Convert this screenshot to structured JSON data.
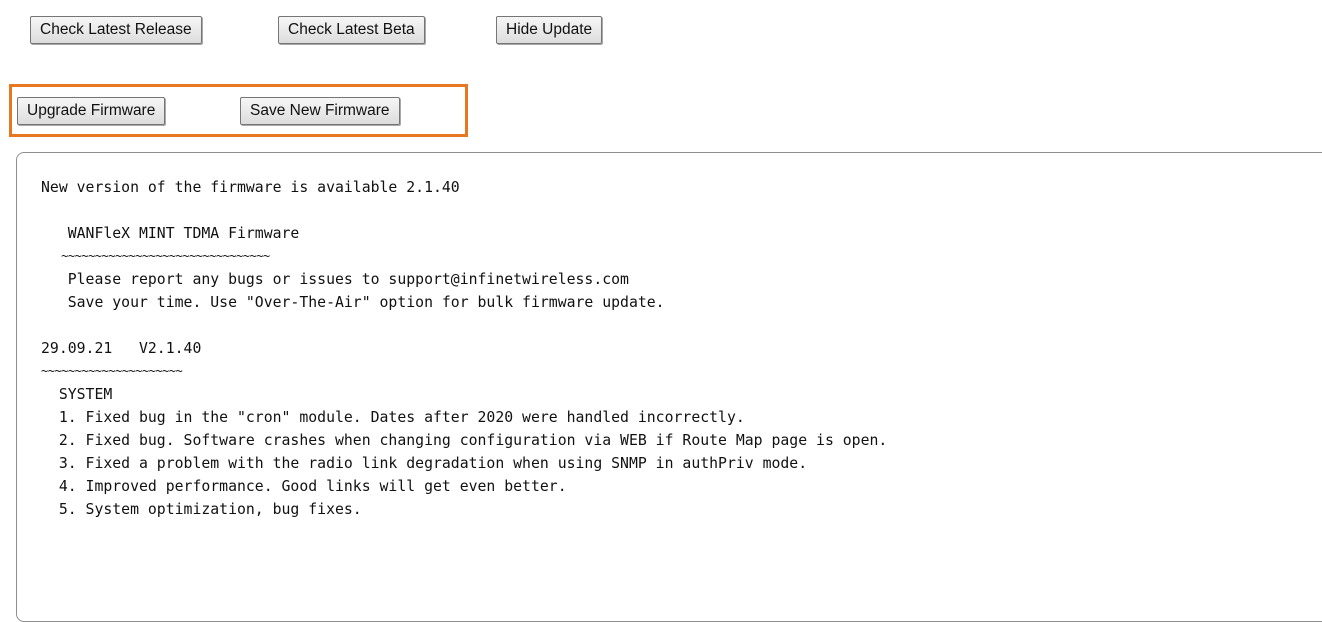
{
  "toolbar": {
    "check_latest_release": "Check Latest Release",
    "check_latest_beta": "Check Latest Beta",
    "hide_update": "Hide Update"
  },
  "firmware_actions": {
    "upgrade_firmware": "Upgrade Firmware",
    "save_new_firmware": "Save New Firmware",
    "highlight_color": "#e87722"
  },
  "release_notes": {
    "header": "New version of the firmware is available 2.1.40",
    "product_title": "   WANFleX MINT TDMA Firmware",
    "product_underline": "   ~~~~~~~~~~~~~~~~~~~~~~~~~~~~~~~",
    "report_line": "   Please report any bugs or issues to support@infinetwireless.com",
    "ota_line": "   Save your time. Use \"Over-The-Air\" option for bulk firmware update.",
    "version_line": "29.09.21   V2.1.40",
    "version_underline": "~~~~~~~~~~~~~~~~~~~~~",
    "section": "  SYSTEM",
    "items": [
      "  1. Fixed bug in the \"cron\" module. Dates after 2020 were handled incorrectly.",
      "  2. Fixed bug. Software crashes when changing configuration via WEB if Route Map page is open.",
      "  3. Fixed a problem with the radio link degradation when using SNMP in authPriv mode.",
      "  4. Improved performance. Good links will get even better.",
      "  5. System optimization, bug fixes."
    ]
  }
}
